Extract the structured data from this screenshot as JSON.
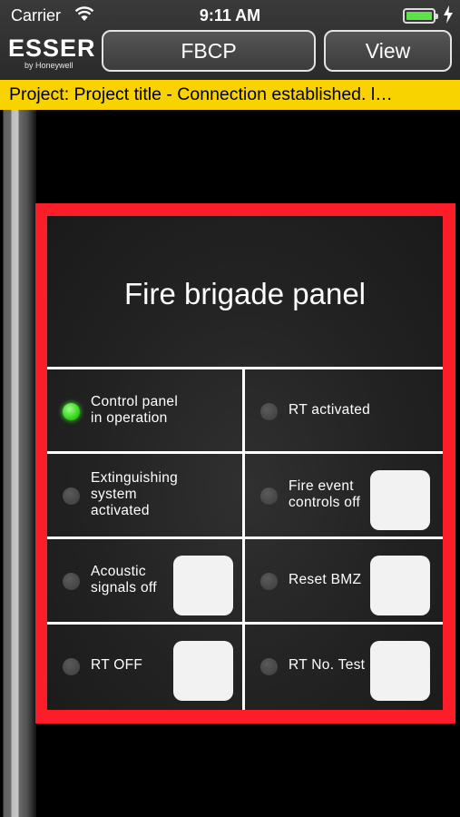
{
  "status_bar": {
    "carrier": "Carrier",
    "time": "9:11 AM",
    "battery_level": 1.0
  },
  "header": {
    "logo_brand": "ESSER",
    "logo_sub": "by Honeywell",
    "fbcp_button": "FBCP",
    "view_button": "View"
  },
  "banner": {
    "text": "Project:  Project title  -  Connection established. l…"
  },
  "panel": {
    "title": "Fire brigade panel",
    "cells": [
      {
        "label": "Control panel in operation",
        "led": "on",
        "has_button": false
      },
      {
        "label": "RT activated",
        "led": "off",
        "has_button": false
      },
      {
        "label": "Extinguishing system activated",
        "led": "off",
        "has_button": false
      },
      {
        "label": "Fire event controls off",
        "led": "off",
        "has_button": true
      },
      {
        "label": "Acoustic signals off",
        "led": "off",
        "has_button": true
      },
      {
        "label": "Reset BMZ",
        "led": "off",
        "has_button": true
      },
      {
        "label": "RT OFF",
        "led": "off",
        "has_button": true
      },
      {
        "label": "RT No. Test",
        "led": "off",
        "has_button": true
      }
    ]
  },
  "colors": {
    "banner": "#f8d300",
    "frame": "#fb1d28",
    "led_on": "#37d61e",
    "led_off": "#3c3c3c"
  },
  "icons": [
    "wifi-icon",
    "battery-icon",
    "charging-bolt-icon",
    "led-indicator-icon"
  ]
}
